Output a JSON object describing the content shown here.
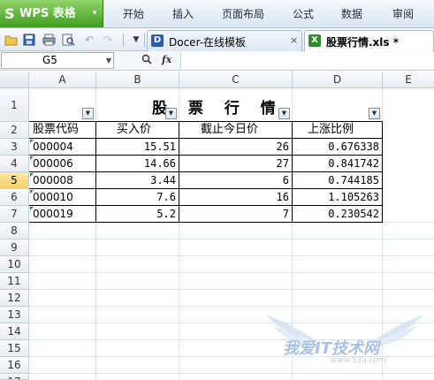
{
  "app": {
    "logo": "S",
    "name": "WPS 表格",
    "arrow": "▾"
  },
  "menu": [
    "开始",
    "插入",
    "页面布局",
    "公式",
    "数据",
    "审阅"
  ],
  "tabs": [
    {
      "label": "Docer-在线模板",
      "icon": "D",
      "close": "×"
    },
    {
      "label": "股票行情.xls *",
      "icon": "X"
    }
  ],
  "formula": {
    "cell_ref": "G5",
    "value": ""
  },
  "columns": [
    "A",
    "B",
    "C",
    "D",
    "E"
  ],
  "rows": [
    "1",
    "2",
    "3",
    "4",
    "5",
    "6",
    "7",
    "8",
    "9",
    "10",
    "11",
    "12",
    "13",
    "14",
    "15",
    "16",
    "17"
  ],
  "selected_row": "5",
  "sheet": {
    "title": "股 票 行 情",
    "headers": [
      "股票代码",
      "买入价",
      "截止今日价",
      "上涨比例"
    ],
    "data": [
      [
        "000004",
        "15.51",
        "26",
        "0.676338"
      ],
      [
        "000006",
        "14.66",
        "27",
        "0.841742"
      ],
      [
        "000008",
        "3.44",
        "6",
        "0.744185"
      ],
      [
        "000010",
        "7.6",
        "16",
        "1.105263"
      ],
      [
        "000019",
        "5.2",
        "7",
        "0.230542"
      ]
    ]
  },
  "watermark": {
    "text": "我爱IT技术网",
    "url": "www.52ij.com"
  },
  "colors": {
    "app_green": "#3f9d1f",
    "selected_row": "#f6cf6a"
  }
}
